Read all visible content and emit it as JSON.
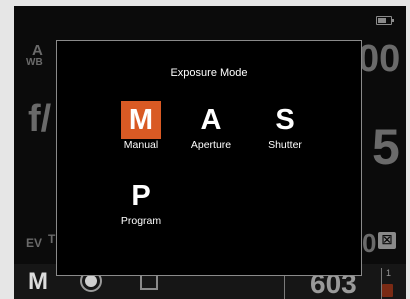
{
  "background": {
    "awb_a": "A",
    "awb_wb": "WB",
    "aperture_prefix": "f/",
    "shutter_suffix": "00",
    "aperture_suffix": "5",
    "ev_label": "EV",
    "ev_tick": "T",
    "exposure_digit": "0",
    "mode_indicator": "M",
    "shots_remaining": "603",
    "card_slot": "1"
  },
  "dialog": {
    "title": "Exposure Mode",
    "modes": [
      {
        "letter": "M",
        "label": "Manual",
        "selected": true
      },
      {
        "letter": "A",
        "label": "Aperture",
        "selected": false
      },
      {
        "letter": "S",
        "label": "Shutter",
        "selected": false
      },
      {
        "letter": "P",
        "label": "Program",
        "selected": false
      }
    ]
  },
  "colors": {
    "selected_mode": "#d95a24",
    "screen": "#0b0b0b",
    "frame": "#e6e6e6"
  },
  "icons": {
    "battery": "battery-icon",
    "record": "record-icon",
    "square": "square-icon",
    "exposure_comp": "exposure-compensation-icon",
    "card": "memory-card-icon"
  }
}
